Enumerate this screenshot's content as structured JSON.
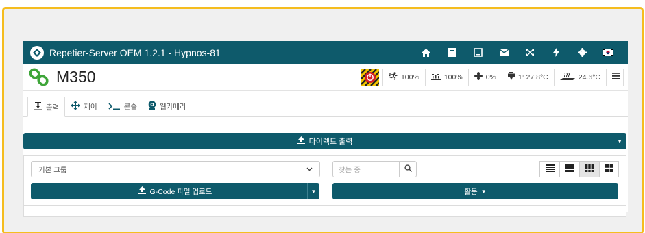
{
  "app": {
    "title": "Repetier-Server OEM 1.2.1 - Hypnos-81",
    "topbar_icons": [
      "home-icon",
      "sd-card-icon",
      "window-icon",
      "envelope-icon",
      "expand-icon",
      "bolt-icon",
      "gear-icon",
      "flag-icon"
    ]
  },
  "printer": {
    "name": "M350",
    "status": {
      "speed": "100%",
      "flow": "100%",
      "fan": "0%",
      "extruder": "1: 27.8°C",
      "bed": "24.6°C"
    }
  },
  "tabs": [
    {
      "label": "출력",
      "icon": "print-icon",
      "active": true
    },
    {
      "label": "제어",
      "icon": "move-icon",
      "active": false
    },
    {
      "label": "콘솔",
      "icon": "terminal-icon",
      "active": false
    },
    {
      "label": "웹카메라",
      "icon": "webcam-icon",
      "active": false
    }
  ],
  "direct_print": {
    "label": "다이렉트 출력"
  },
  "group_select": {
    "value": "기본 그룹"
  },
  "search": {
    "placeholder": "찾는 중"
  },
  "upload": {
    "label": "G-Code 파일 업로드"
  },
  "activity": {
    "label": "활동"
  },
  "colors": {
    "primary": "#0e5a6b",
    "frame": "#f5bd1f"
  }
}
